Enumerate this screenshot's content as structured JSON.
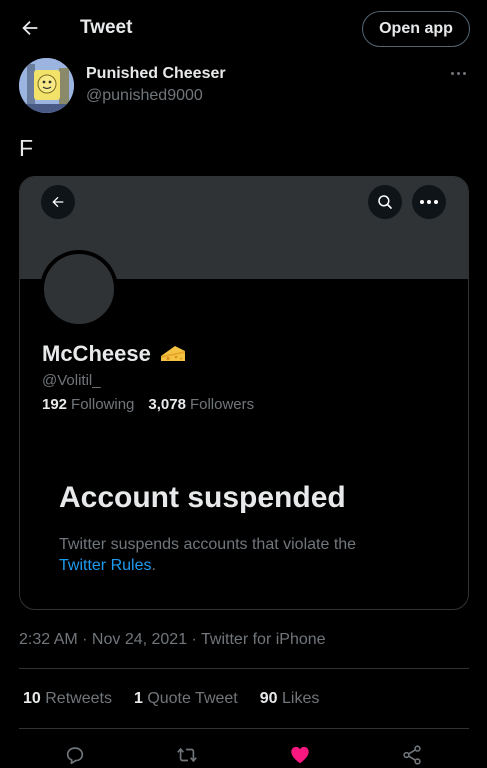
{
  "header": {
    "title": "Tweet",
    "open_app_label": "Open app"
  },
  "tweet": {
    "author_name": "Punished Cheeser",
    "author_handle": "@punished9000",
    "text": "F",
    "timestamp": "2:32 AM · Nov 24, 2021 · Twitter for iPhone"
  },
  "embedded_profile": {
    "name": "McCheese",
    "emoji": "🧀",
    "handle": "@Volitil_",
    "following_count": "192",
    "following_label": "Following",
    "followers_count": "3,078",
    "followers_label": "Followers",
    "suspended_title": "Account suspended",
    "suspended_text": "Twitter suspends accounts that violate the",
    "suspended_link": "Twitter Rules",
    "suspended_period": "."
  },
  "stats": {
    "retweets_count": "10",
    "retweets_label": "Retweets",
    "quotes_count": "1",
    "quotes_label": "Quote Tweet",
    "likes_count": "90",
    "likes_label": "Likes"
  },
  "colors": {
    "background": "#000000",
    "accent": "#1d9bf0",
    "like": "#f91880",
    "muted": "#71767b"
  },
  "icons": [
    "back-arrow-icon",
    "more-icon",
    "search-icon",
    "reply-icon",
    "retweet-icon",
    "heart-icon",
    "share-icon"
  ]
}
